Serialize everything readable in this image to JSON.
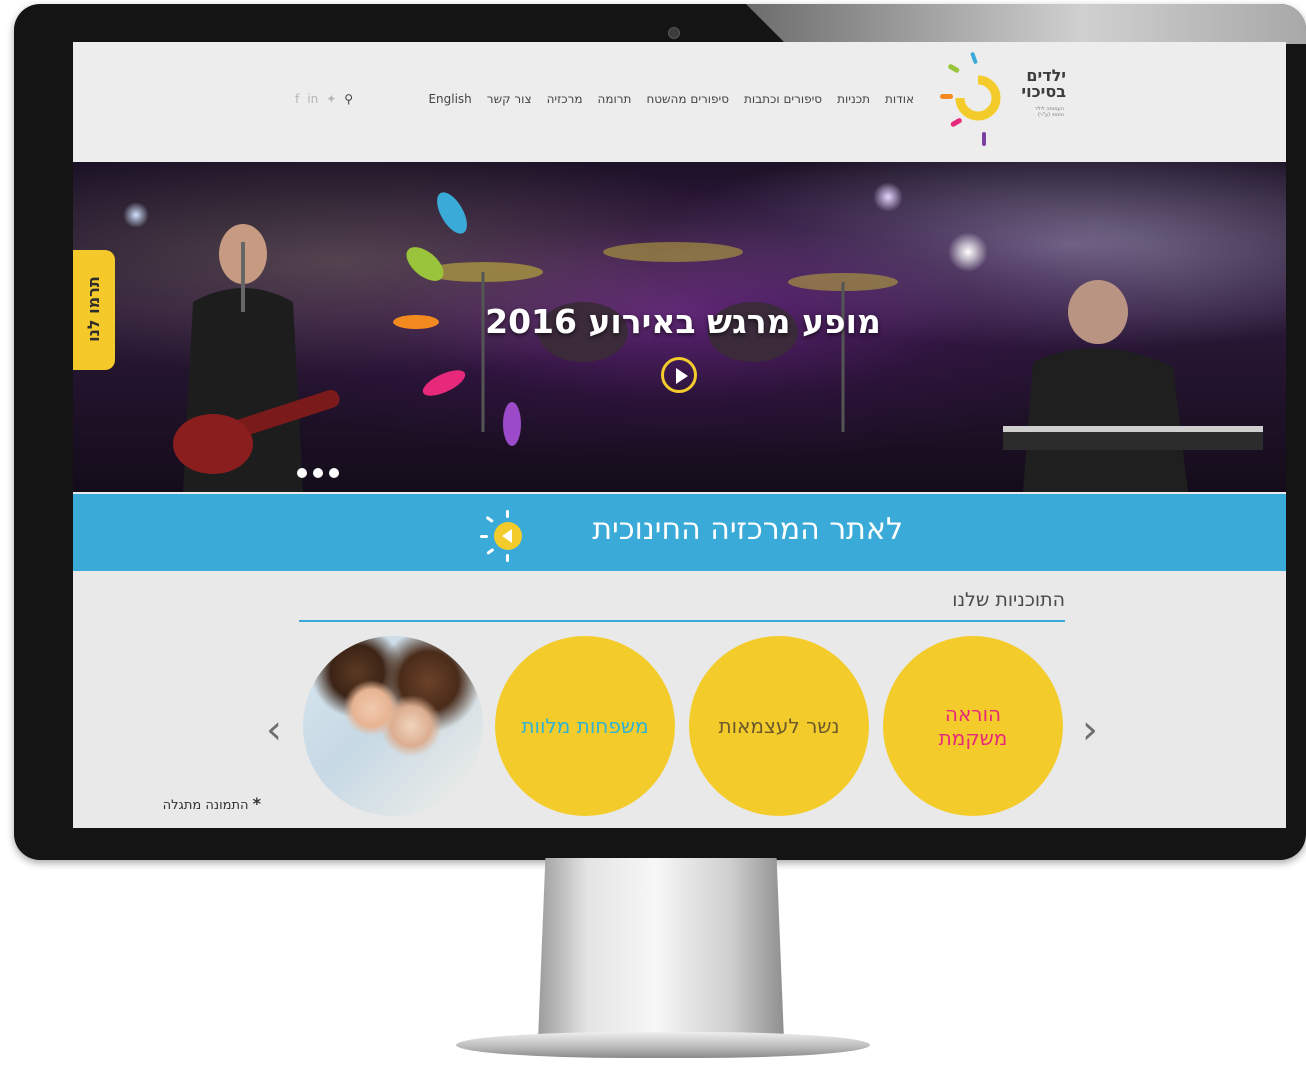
{
  "header": {
    "logo": {
      "title_line1": "ילדים",
      "title_line2": "בסיכוי",
      "subtitle_line1": "העמותה לילד",
      "subtitle_line2": "החסוי (ע\"ר)"
    },
    "nav": [
      "אודות",
      "תכניות",
      "סיפורים וכתבות",
      "סיפורים מהשטח",
      "תרומה",
      "מרכזיה",
      "צור קשר",
      "English"
    ],
    "social_icons": [
      "facebook-icon",
      "linkedin-icon",
      "twitter-icon",
      "search-icon"
    ]
  },
  "hero": {
    "title": "מופע מרגש באירוע 2016",
    "slides_count": 3,
    "donate_label": "תרמו לנו"
  },
  "education_bar": {
    "label": "לאתר המרכזיה החינוכית"
  },
  "programs": {
    "title": "התוכניות שלנו",
    "items": [
      {
        "label_line1": "הוראה",
        "label_line2": "משקמת",
        "color": "#e6297a"
      },
      {
        "label_line1": "נשר לעצמאות",
        "color": "#6c5a2a"
      },
      {
        "label_line1": "משפחות מלוות",
        "color": "#2fb3d4"
      }
    ]
  },
  "photo_note": "התמונה מתגלה",
  "colors": {
    "yellow": "#f3cc2b",
    "blue": "#3aaad8",
    "pink": "#e6297a"
  }
}
